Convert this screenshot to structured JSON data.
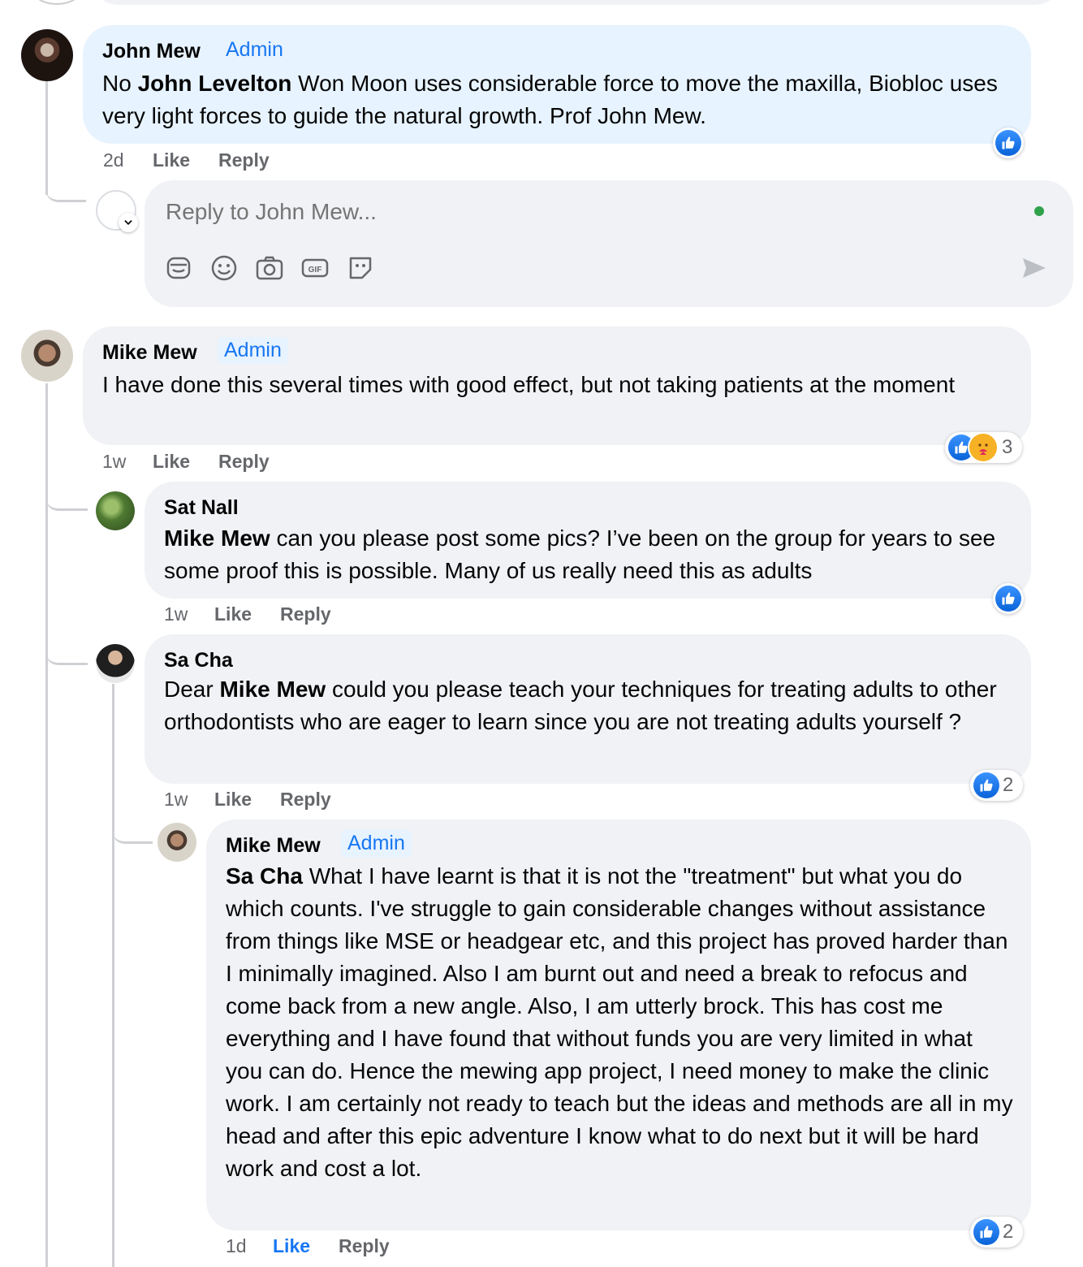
{
  "comments": [
    {
      "author": "John Mew",
      "badge": "Admin",
      "mention": "John Levelton",
      "text": " Won Moon uses considerable force to move the maxilla, Biobloc uses very light forces to guide the natural growth. Prof John Mew.",
      "prefix": "No ",
      "time": "2d",
      "like": "Like",
      "reply": "Reply"
    },
    {
      "author": "Mike Mew",
      "badge": "Admin",
      "text": "I have done this several times with good effect, but not taking patients at the moment",
      "time": "1w",
      "like": "Like",
      "reply": "Reply",
      "reaction_count": "3"
    },
    {
      "author": "Sat Nall",
      "mention": "Mike Mew",
      "text": " can you please post some pics? I’ve been on the group for years to see some proof this is possible. Many of us really need this as adults",
      "time": "1w",
      "like": "Like",
      "reply": "Reply"
    },
    {
      "author": "Sa Cha",
      "prefix": "Dear ",
      "mention": "Mike Mew",
      "text": " could you please teach your techniques for treating adults to other orthodontists who are eager to learn since you are not treating adults yourself ?",
      "time": "1w",
      "like": "Like",
      "reply": "Reply",
      "reaction_count": "2"
    },
    {
      "author": "Mike Mew",
      "badge": "Admin",
      "mention": "Sa Cha",
      "text": " What I have learnt is that it is not the \"treatment\" but what you do which counts. I've struggle to gain considerable changes without assistance from things like MSE or headgear etc, and this project has proved harder than I minimally imagined. Also I am burnt out and need a break to refocus and come back from a new angle. Also, I am utterly brock. This has cost me everything and I have found that without funds you are very limited in what you can do. Hence the mewing app project, I need money to make the clinic work. I am certainly not ready to teach but the ideas and methods are all in my head and after this epic adventure I know what to do next but it will be hard work and cost a lot.",
      "time": "1d",
      "like": "Like",
      "reply": "Reply",
      "reaction_count": "2"
    }
  ],
  "reply_input": {
    "placeholder": "Reply to John Mew..."
  },
  "icons": [
    "avatar-sticker-icon",
    "emoji-icon",
    "camera-icon",
    "gif-icon",
    "sticker-icon",
    "send-icon",
    "like-reaction-icon",
    "care-reaction-icon"
  ],
  "colors": {
    "accent": "#1877f2",
    "bubble": "#f0f2f5",
    "highlight": "#e7f3ff",
    "online": "#31a24c"
  }
}
